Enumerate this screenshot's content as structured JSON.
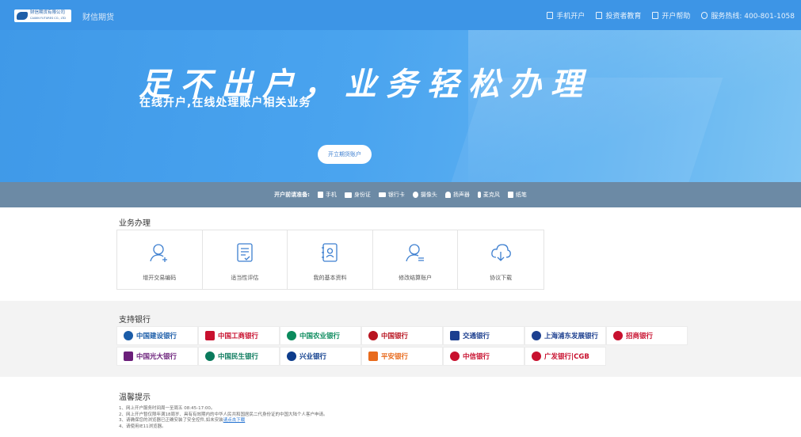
{
  "header": {
    "logo_text": "财信期货有限公司",
    "logo_sub": "CAIXIN FUTURES CO., LTD",
    "brand_label": "财信期货",
    "nav": [
      {
        "label": "手机开户",
        "icon": "mobile-icon"
      },
      {
        "label": "投资者教育",
        "icon": "book-icon"
      },
      {
        "label": "开户帮助",
        "icon": "help-doc-icon"
      },
      {
        "label": "服务热线: 400-801-1058",
        "icon": "phone-icon"
      }
    ]
  },
  "hero": {
    "title": "足不出户，业务轻松办理",
    "subtitle": "在线开户,在线处理账户相关业务",
    "open_button": "开立期货账户"
  },
  "requirements": {
    "label": "开户前请准备:",
    "items": [
      {
        "label": "手机",
        "icon": "mobile-icon"
      },
      {
        "label": "身份证",
        "icon": "id-card-icon"
      },
      {
        "label": "银行卡",
        "icon": "bank-card-icon"
      },
      {
        "label": "摄像头",
        "icon": "camera-icon"
      },
      {
        "label": "扬声器",
        "icon": "headphone-icon"
      },
      {
        "label": "麦克风",
        "icon": "microphone-icon"
      },
      {
        "label": "纸笔",
        "icon": "pen-paper-icon"
      }
    ]
  },
  "business": {
    "title": "业务办理",
    "items": [
      {
        "label": "增开交易编码",
        "icon": "add-user-icon"
      },
      {
        "label": "适当性评估",
        "icon": "assessment-form-icon"
      },
      {
        "label": "我的基本资料",
        "icon": "profile-card-icon"
      },
      {
        "label": "修改结算账户",
        "icon": "edit-user-icon"
      },
      {
        "label": "协议下载",
        "icon": "cloud-download-icon"
      }
    ]
  },
  "banks": {
    "title": "支持银行",
    "items": [
      {
        "name": "中国建设银行",
        "color": "#1a5ca8"
      },
      {
        "name": "中国工商银行",
        "color": "#c8102e"
      },
      {
        "name": "中国农业银行",
        "color": "#0a8a5c"
      },
      {
        "name": "中国银行",
        "color": "#b8131f"
      },
      {
        "name": "交通银行",
        "color": "#1c3f8f"
      },
      {
        "name": "上海浦东发展银行",
        "color": "#1c3f8f"
      },
      {
        "name": "招商银行",
        "color": "#c8102e"
      },
      {
        "name": "中国光大银行",
        "color": "#6b1f7a"
      },
      {
        "name": "中国民生银行",
        "color": "#0a7a5c"
      },
      {
        "name": "兴业银行",
        "color": "#0d3c8c"
      },
      {
        "name": "平安银行",
        "color": "#e86a1c"
      },
      {
        "name": "中信银行",
        "color": "#c8102e"
      },
      {
        "name": "广发银行|CGB",
        "color": "#c8102e"
      }
    ]
  },
  "tips": {
    "title": "温馨提示",
    "lines": [
      "1、网上开户服务时间周一至周五 08:45-17:00。",
      "2、网上开户暂仅限年满18周岁、具有有效期内的中华人民共和国居民二代身份证的中国大陆个人客户申请。",
      "3、请确保您的浏览器已正确安装了安全控件,如未安装",
      "4、请使用IE11浏览器。"
    ],
    "link_text": "请点击下载"
  },
  "colors": {
    "nav_bg": "#3d95e6",
    "hero_bg": "#4aa4ef",
    "req_bar": "#6c8aa5",
    "icon_blue": "#3d7fd0"
  }
}
